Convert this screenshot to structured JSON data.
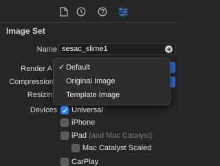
{
  "toolbar": {
    "icons": [
      "file-icon",
      "history-icon",
      "help-icon",
      "attributes-icon"
    ],
    "accent": "#2e7bf6"
  },
  "section": {
    "title": "Image Set"
  },
  "fields": {
    "name_label": "Name",
    "name_value": "sesac_slime1",
    "render_label": "Render A",
    "compression_label": "Compression",
    "resizing_label": "Resizin",
    "devices_label": "Devices"
  },
  "render_menu": {
    "options": [
      {
        "label": "Default",
        "checked": true,
        "check_glyph": "✓"
      },
      {
        "label": "Original Image",
        "checked": false
      },
      {
        "label": "Template Image",
        "checked": false
      }
    ]
  },
  "devices": [
    {
      "label": "Universal",
      "checked": true
    },
    {
      "label": "iPhone",
      "checked": false
    },
    {
      "label": "iPad",
      "suffix": "(and Mac Catalyst)",
      "checked": false
    },
    {
      "label": "Mac Catalyst Scaled",
      "checked": false
    },
    {
      "label": "CarPlay",
      "checked": false
    }
  ]
}
